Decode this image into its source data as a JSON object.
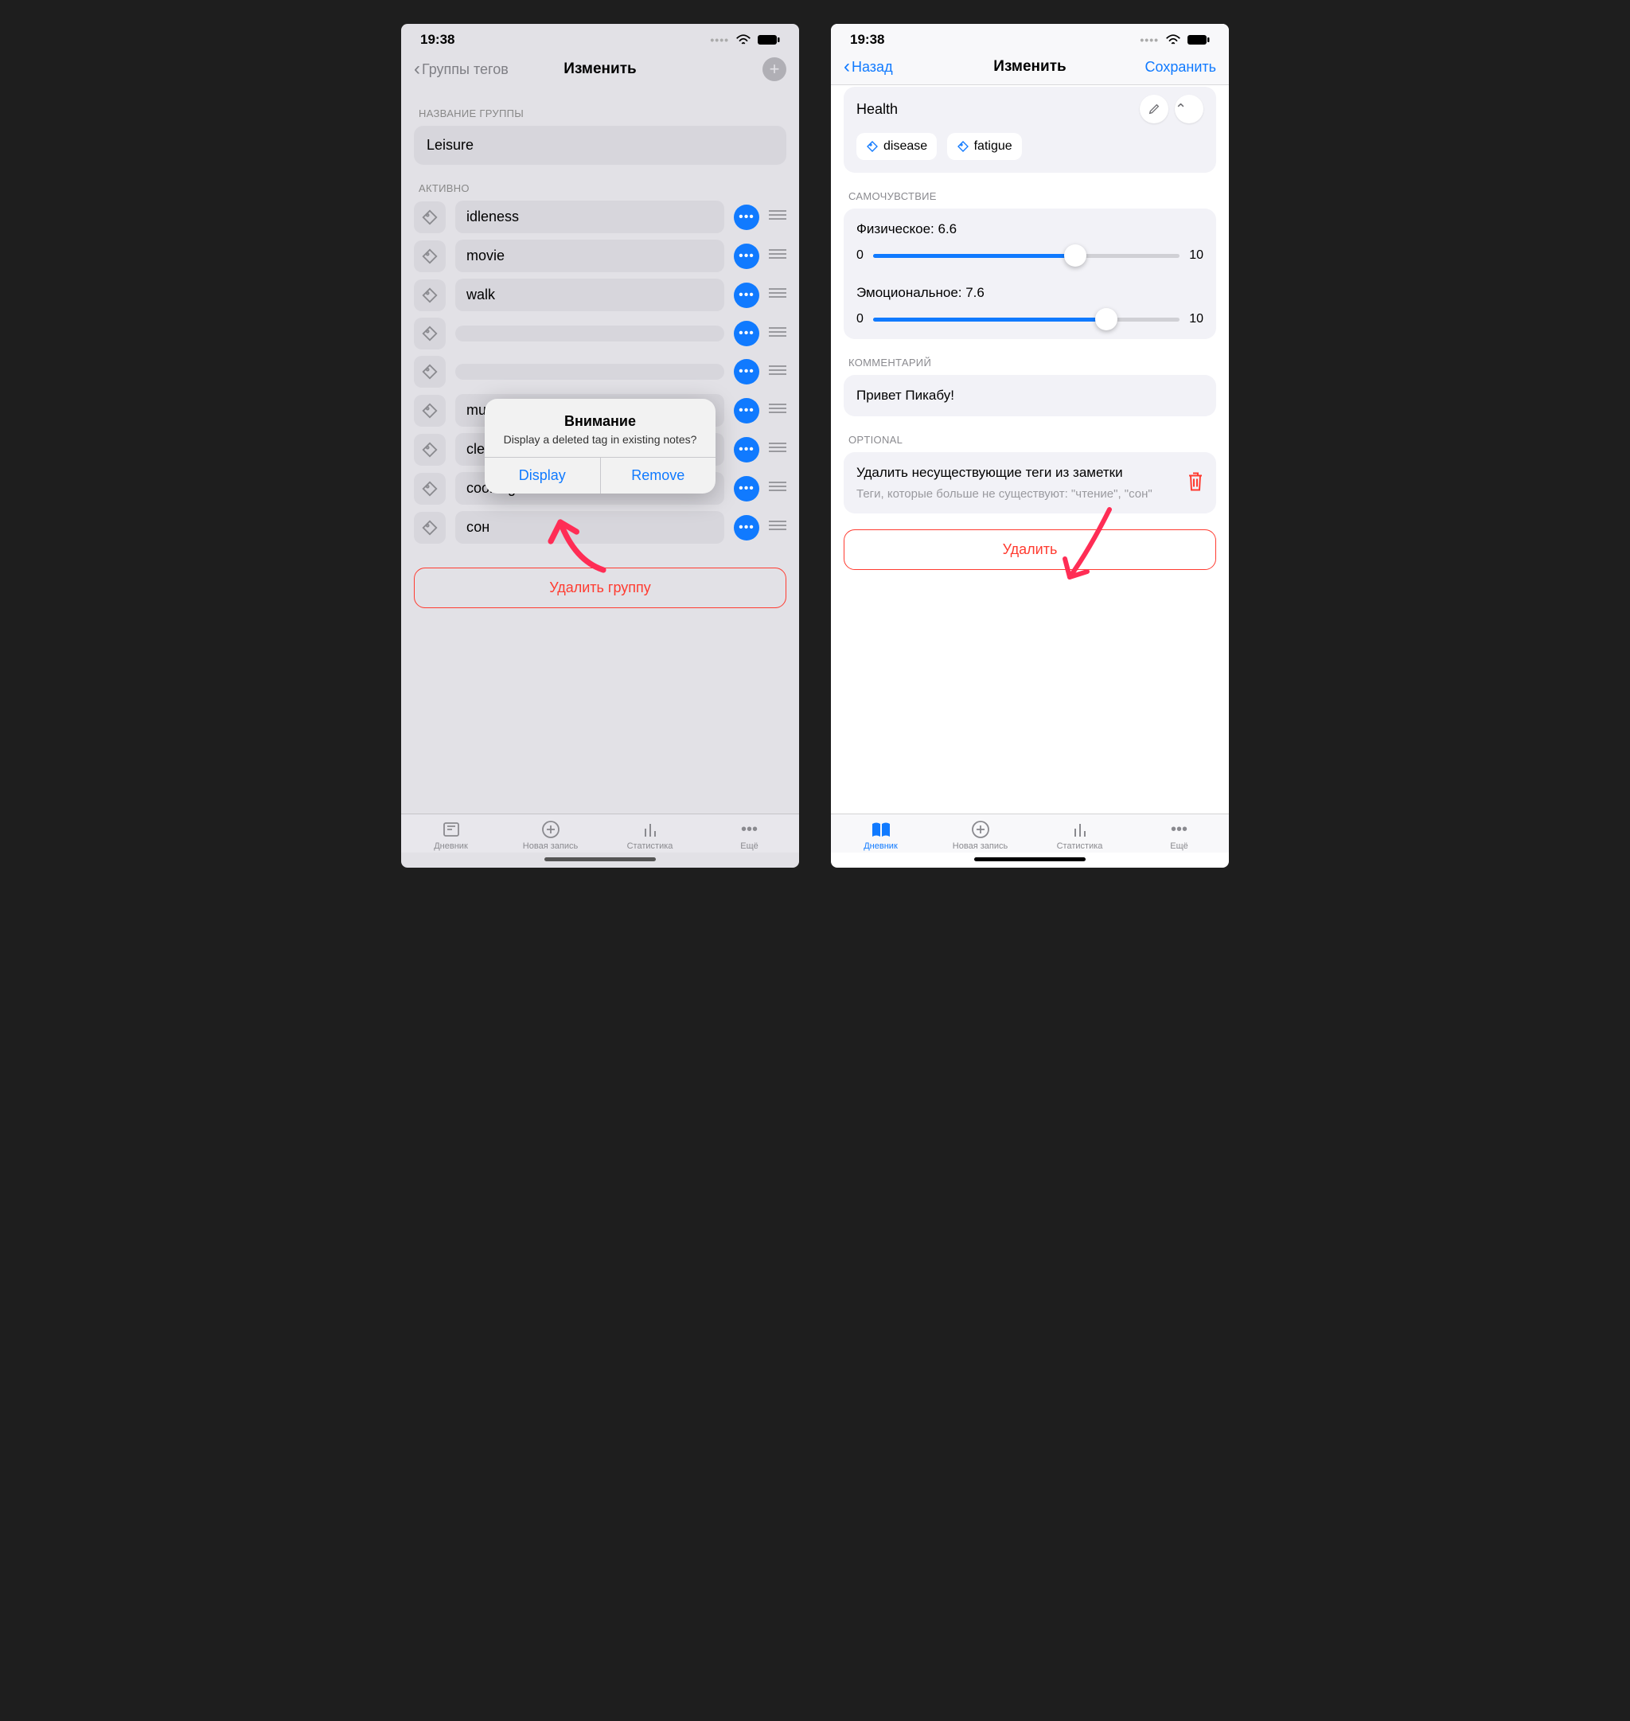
{
  "status": {
    "time": "19:38"
  },
  "left": {
    "nav": {
      "back": "Группы тегов",
      "title": "Изменить"
    },
    "sections": {
      "group_name_label": "НАЗВАНИЕ ГРУППЫ",
      "active_label": "АКТИВНО"
    },
    "group_name_value": "Leisure",
    "tags": [
      {
        "label": "idleness"
      },
      {
        "label": "movie"
      },
      {
        "label": "walk"
      },
      {
        "label": ""
      },
      {
        "label": ""
      },
      {
        "label": "music"
      },
      {
        "label": "cleaning"
      },
      {
        "label": "cooking"
      },
      {
        "label": "сон"
      }
    ],
    "delete_group": "Удалить группу",
    "alert": {
      "title": "Внимание",
      "message": "Display a deleted tag in existing notes?",
      "display": "Display",
      "remove": "Remove"
    }
  },
  "right": {
    "nav": {
      "back": "Назад",
      "title": "Изменить",
      "save": "Сохранить"
    },
    "health": {
      "title": "Health",
      "tags": [
        "disease",
        "fatigue"
      ]
    },
    "wellbeing": {
      "section_label": "САМОЧУВСТВИЕ",
      "physical": {
        "label": "Физическое: 6.6",
        "min": "0",
        "max": "10",
        "percent": 66
      },
      "emotional": {
        "label": "Эмоциональное: 7.6",
        "min": "0",
        "max": "10",
        "percent": 76
      }
    },
    "comment": {
      "section_label": "КОММЕНТАРИЙ",
      "text": "Привет Пикабу!"
    },
    "optional": {
      "section_label": "OPTIONAL",
      "title": "Удалить несуществующие теги из заметки",
      "subtitle": "Теги, которые больше не существуют: \"чтение\", \"сон\""
    },
    "delete": "Удалить"
  },
  "tabs": {
    "diary": "Дневник",
    "new_entry": "Новая запись",
    "stats": "Статистика",
    "more": "Ещё"
  }
}
